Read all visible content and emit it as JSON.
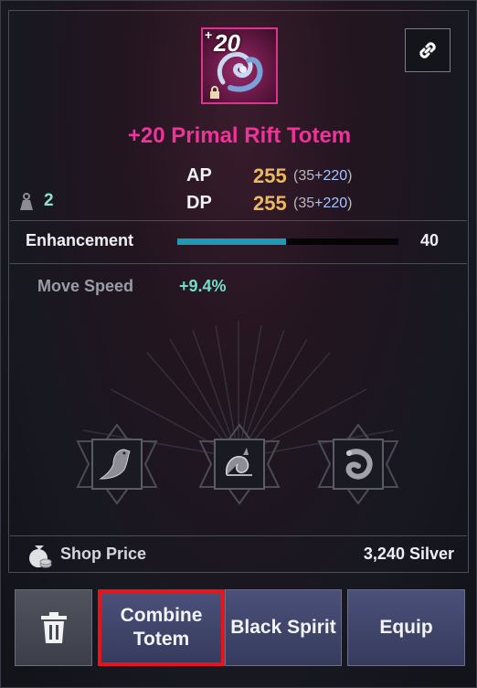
{
  "item": {
    "enhance_plus": "+",
    "enhance_level": "20",
    "name": "+20 Primal Rift Totem",
    "rarity_color": "#f0329a"
  },
  "stats": {
    "ap_label": "AP",
    "ap_value": "255",
    "ap_base": "(35",
    "ap_bonus": "+220",
    "ap_close": ")",
    "dp_label": "DP",
    "dp_value": "255",
    "dp_base": "(35",
    "dp_bonus": "+220",
    "dp_close": ")",
    "weight": "2"
  },
  "enhancement": {
    "label": "Enhancement",
    "value": "40",
    "progress": 0.49
  },
  "bonus": {
    "label": "Move Speed",
    "value": "+9.4%"
  },
  "sockets": [
    {
      "icon": "bird-totem-icon"
    },
    {
      "icon": "shell-totem-icon"
    },
    {
      "icon": "serpent-totem-icon"
    }
  ],
  "shop": {
    "label": "Shop Price",
    "value": "3,240 Silver"
  },
  "buttons": {
    "trash_icon": "trash-icon",
    "combine_line1": "Combine",
    "combine_line2": "Totem",
    "black_spirit": "Black Spirit",
    "equip": "Equip"
  },
  "colors": {
    "highlight_border": "#e8141c",
    "enhance_bar": "#1f9ab4",
    "stat_value": "#ecb860",
    "bonus_value": "#6ee0c8"
  }
}
